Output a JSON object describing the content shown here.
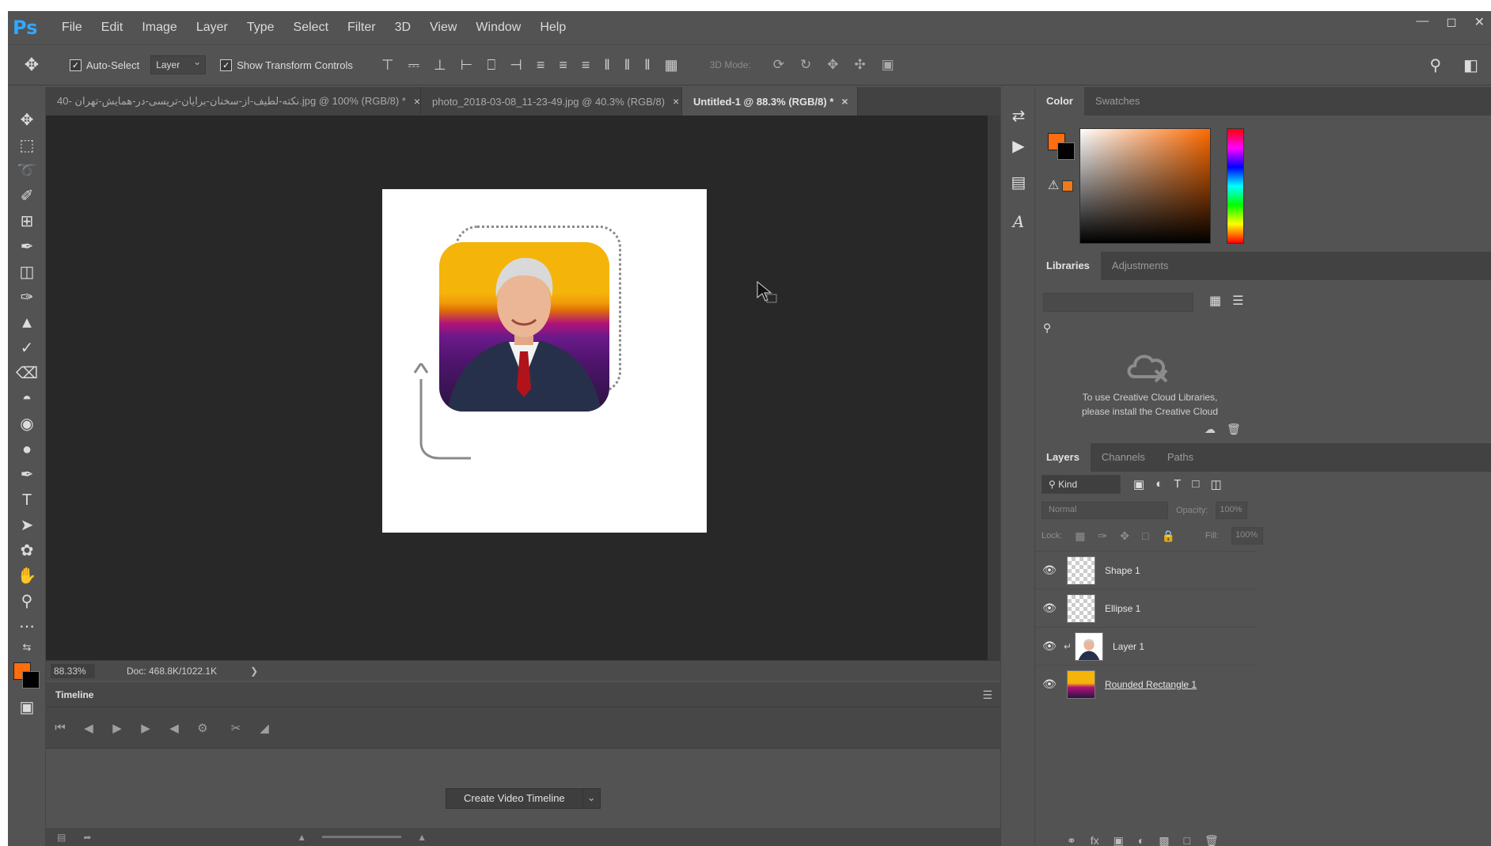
{
  "app": {
    "logo": "Ps"
  },
  "menu": [
    "File",
    "Edit",
    "Image",
    "Layer",
    "Type",
    "Select",
    "Filter",
    "3D",
    "View",
    "Window",
    "Help"
  ],
  "options": {
    "auto_select_label": "Auto-Select",
    "auto_select_target": "Layer",
    "show_transform_label": "Show Transform Controls",
    "mode_3d_label": "3D Mode:"
  },
  "tabs": [
    {
      "label": "40- نکته-لطیف-از-سخنان-برایان-تریسی-در-همایش-تهران.jpg @ 100% (RGB/8) *",
      "close": "×"
    },
    {
      "label": "photo_2018-03-08_11-23-49.jpg @ 40.3% (RGB/8)",
      "close": "×"
    },
    {
      "label": "Untitled-1 @ 88.3% (RGB/8) *",
      "close": "×"
    }
  ],
  "status": {
    "zoom": "88.33%",
    "doc_info": "Doc: 468.8K/1022.1K",
    "arrow": "❯"
  },
  "timeline": {
    "tab_label": "Timeline",
    "create_button_label": "Create Video Timeline",
    "dropdown_glyph": "⌄"
  },
  "color_panel": {
    "tabs": [
      "Color",
      "Swatches"
    ],
    "foreground_color": "#ff6d0e",
    "background_color": "#000000"
  },
  "libraries_panel": {
    "tabs": [
      "Libraries",
      "Adjustments"
    ],
    "message_line1": "To use Creative Cloud Libraries,",
    "message_line2": "please install the Creative Cloud"
  },
  "layers_panel": {
    "tabs": [
      "Layers",
      "Channels",
      "Paths"
    ],
    "kind_label": "Kind",
    "blend_mode": "Normal",
    "opacity_label": "Opacity:",
    "opacity_value": "100%",
    "lock_label": "Lock:",
    "fill_label": "Fill:",
    "fill_value": "100%",
    "layers": [
      {
        "name": "Shape 1",
        "visible": true
      },
      {
        "name": "Ellipse 1",
        "visible": true
      },
      {
        "name": "Layer 1",
        "visible": true
      },
      {
        "name": "Rounded Rectangle 1",
        "visible": true
      }
    ]
  }
}
